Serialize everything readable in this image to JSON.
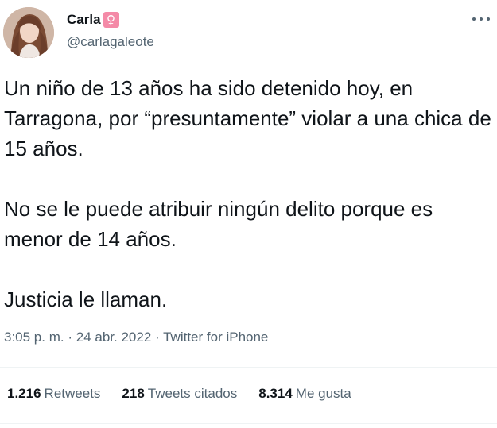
{
  "author": {
    "display_name": "Carla",
    "name_emoji": "♀",
    "handle": "@carlagaleote",
    "avatar_icon": "profile-photo"
  },
  "tweet": {
    "paragraphs": [
      "Un niño de 13 años ha sido detenido hoy, en Tarragona, por “presuntamente” violar a una chica de 15 años.",
      "No se le puede atribuir ningún delito porque es menor de 14 años.",
      "Justicia le llaman."
    ],
    "time": "3:05 p. m.",
    "separator": "·",
    "date": "24 abr. 2022",
    "source": "Twitter for iPhone"
  },
  "stats": {
    "retweets_count": "1.216",
    "retweets_label": "Retweets",
    "quotes_count": "218",
    "quotes_label": "Tweets citados",
    "likes_count": "8.314",
    "likes_label": "Me gusta"
  },
  "colors": {
    "primary_text": "#0f1419",
    "secondary_text": "#536471",
    "divider": "#eff3f4",
    "emoji_bg": "#f48aa7"
  }
}
